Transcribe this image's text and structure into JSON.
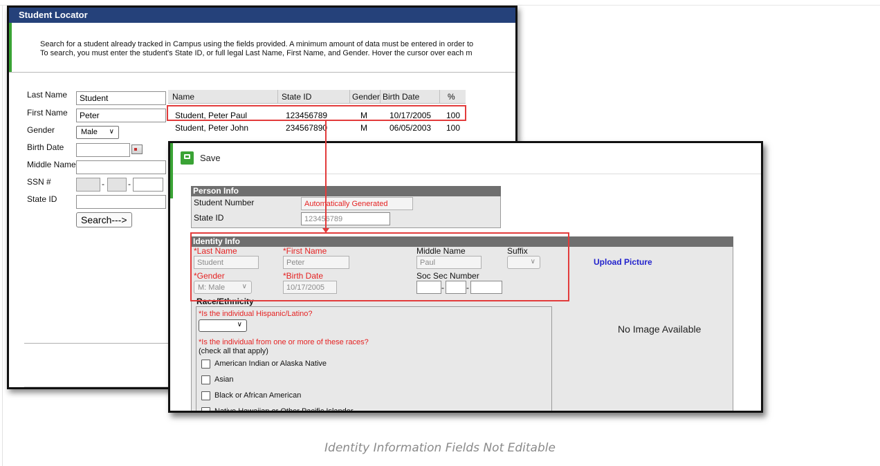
{
  "locator": {
    "title": "Student Locator",
    "instructions_line1": "Search for a student already tracked in Campus using the fields provided. A minimum amount of data must be entered in order to",
    "instructions_line2": "To search, you must enter the student's State ID, or full legal Last Name, First Name, and Gender. Hover the cursor over each m",
    "fields": {
      "last_name_label": "Last Name",
      "last_name_value": "Student",
      "first_name_label": "First Name",
      "first_name_value": "Peter",
      "gender_label": "Gender",
      "gender_value": "Male",
      "birth_date_label": "Birth Date",
      "birth_date_value": "",
      "middle_name_label": "Middle Name",
      "middle_name_value": "",
      "ssn_label": "SSN #",
      "state_id_label": "State ID",
      "state_id_value": "",
      "search_button": "Search--->"
    },
    "results": {
      "columns": [
        "Name",
        "State ID",
        "Gender",
        "Birth Date",
        "%"
      ],
      "rows": [
        {
          "name": "Student, Peter Paul",
          "state_id": "123456789",
          "gender": "M",
          "birth_date": "10/17/2005",
          "pct": "100"
        },
        {
          "name": "Student, Peter John",
          "state_id": "234567890",
          "gender": "M",
          "birth_date": "06/05/2003",
          "pct": "100"
        }
      ]
    }
  },
  "editor": {
    "save_label": "Save",
    "person_info": {
      "title": "Person Info",
      "student_number_label": "Student Number",
      "student_number_value": "Automatically Generated",
      "state_id_label": "State ID",
      "state_id_value": "123456789"
    },
    "identity_info": {
      "title": "Identity Info",
      "last_name_label": "*Last Name",
      "last_name_value": "Student",
      "first_name_label": "*First Name",
      "first_name_value": "Peter",
      "middle_name_label": "Middle Name",
      "middle_name_value": "Paul",
      "suffix_label": "Suffix",
      "suffix_value": "",
      "gender_label": "*Gender",
      "gender_value": "M: Male",
      "birth_date_label": "*Birth Date",
      "birth_date_value": "10/17/2005",
      "ssn_label": "Soc Sec Number",
      "upload_picture": "Upload Picture",
      "no_image": "No Image Available"
    },
    "race_ethnicity": {
      "title": "Race/Ethnicity",
      "hispanic_question": "*Is the individual Hispanic/Latino?",
      "hispanic_value": "",
      "races_question": "*Is the individual from one or more of these races?",
      "check_all": "(check all that apply)",
      "options": [
        "American Indian or Alaska Native",
        "Asian",
        "Black or African American",
        "Native Hawaiian or Other Pacific Islander"
      ]
    }
  },
  "caption": "Identity Information Fields Not Editable",
  "colors": {
    "title_bar": "#25417a",
    "accent_green": "#3aa335",
    "section_header": "#6f6f6f",
    "required_red": "#e52222",
    "highlight_red": "#e23b3b",
    "link_blue": "#2222cc"
  }
}
